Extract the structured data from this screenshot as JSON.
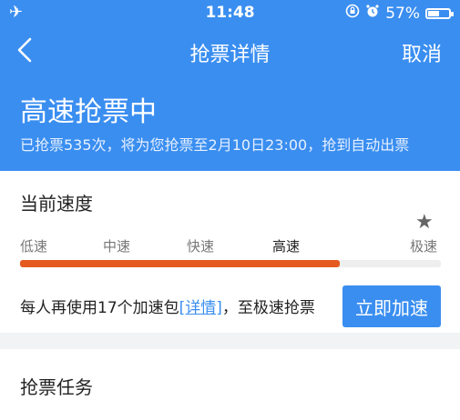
{
  "status_bar": {
    "airplane_icon": "airplane-icon",
    "time": "11:48",
    "battery_percent": "57%",
    "battery_level": 0.57
  },
  "nav": {
    "back_glyph": "❮",
    "title": "抢票详情",
    "cancel": "取消"
  },
  "hero": {
    "title": "高速抢票中",
    "subtitle": "已抢票535次，将为您抢票至2月10日23:00，抢到自动出票"
  },
  "speed": {
    "section_title": "当前速度",
    "levels": [
      "低速",
      "中速",
      "快速",
      "高速",
      "极速"
    ],
    "current_level": "高速",
    "progress": 0.76,
    "boost_text_prefix": "每人再使用17个加速包",
    "boost_link": "[详情]",
    "boost_text_suffix": "，至极速抢票",
    "boost_button": "立即加速"
  },
  "task": {
    "section_title": "抢票任务"
  },
  "colors": {
    "primary": "#3a8ef0",
    "progress": "#e45a1f"
  }
}
